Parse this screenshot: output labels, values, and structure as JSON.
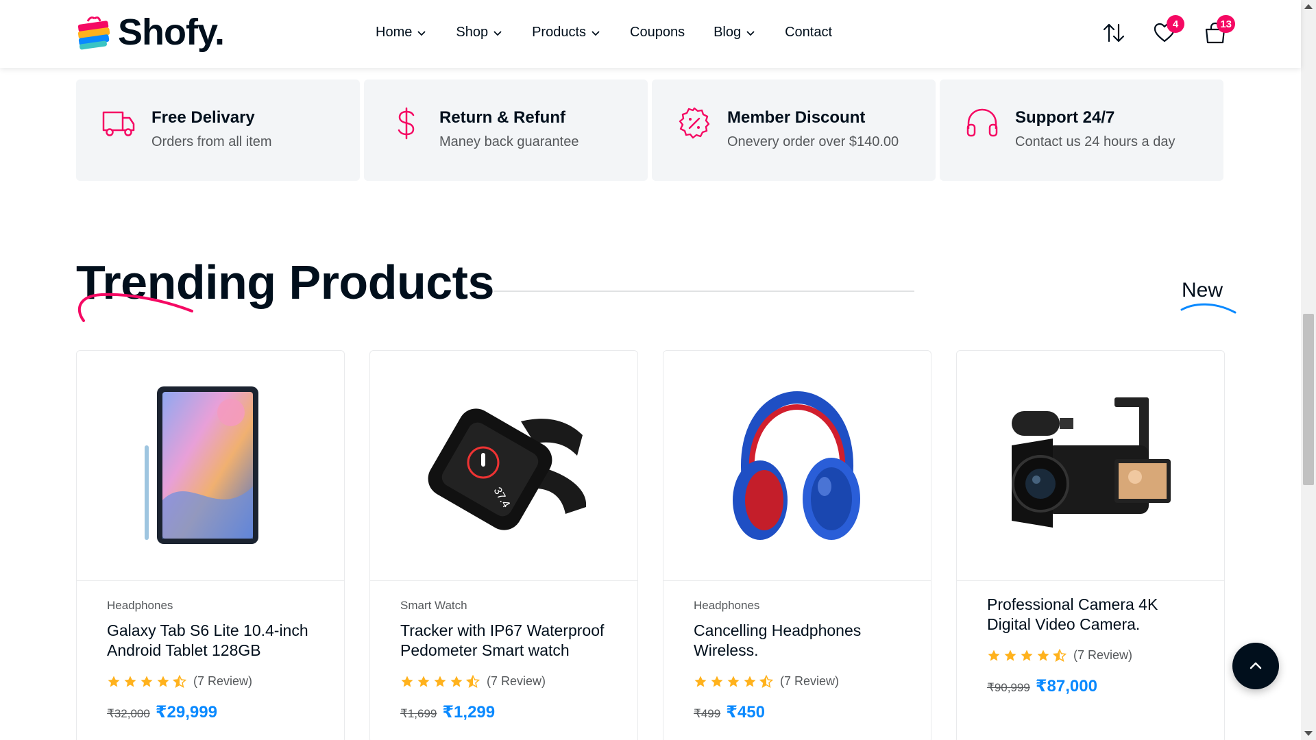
{
  "header": {
    "logo_text": "Shofy.",
    "nav": [
      {
        "label": "Home",
        "has_dropdown": true
      },
      {
        "label": "Shop",
        "has_dropdown": true
      },
      {
        "label": "Products",
        "has_dropdown": true
      },
      {
        "label": "Coupons",
        "has_dropdown": false
      },
      {
        "label": "Blog",
        "has_dropdown": true
      },
      {
        "label": "Contact",
        "has_dropdown": false
      }
    ],
    "wishlist_count": "4",
    "cart_count": "13"
  },
  "features": [
    {
      "icon": "delivery-truck-icon",
      "title": "Free Delivary",
      "subtitle": "Orders from all item"
    },
    {
      "icon": "dollar-icon",
      "title": "Return & Refunf",
      "subtitle": "Maney back guarantee"
    },
    {
      "icon": "discount-badge-icon",
      "title": "Member Discount",
      "subtitle": "Onevery order over $140.00"
    },
    {
      "icon": "headphones-icon",
      "title": "Support 24/7",
      "subtitle": "Contact us 24 hours a day"
    }
  ],
  "section": {
    "title": "Trending Products",
    "tab_label": "New"
  },
  "products": [
    {
      "image": "tablet-image",
      "category": "Headphones",
      "name": "Galaxy Tab S6 Lite 10.4-inch Android Tablet 128GB",
      "rating": 4.5,
      "review_text": "(7 Review)",
      "old_price": "₹32,000",
      "price": "₹29,999"
    },
    {
      "image": "smartwatch-image",
      "category": "Smart Watch",
      "name": "Tracker with IP67 Waterproof Pedometer Smart watch",
      "rating": 4.5,
      "review_text": "(7 Review)",
      "old_price": "₹1,699",
      "price": "₹1,299"
    },
    {
      "image": "headphones-image",
      "category": "Headphones",
      "name": "Cancelling Headphones Wireless.",
      "rating": 4.5,
      "review_text": "(7 Review)",
      "old_price": "₹499",
      "price": "₹450"
    },
    {
      "image": "camera-image",
      "category": "",
      "name": "Professional Camera 4K Digital Video Camera.",
      "rating": 4.5,
      "review_text": "(7 Review)",
      "old_price": "₹90,999",
      "price": "₹87,000"
    }
  ],
  "colors": {
    "accent_pink": "#f50963",
    "price_blue": "#0989ff",
    "star_orange": "#ffb21d",
    "dark": "#010f1c"
  }
}
